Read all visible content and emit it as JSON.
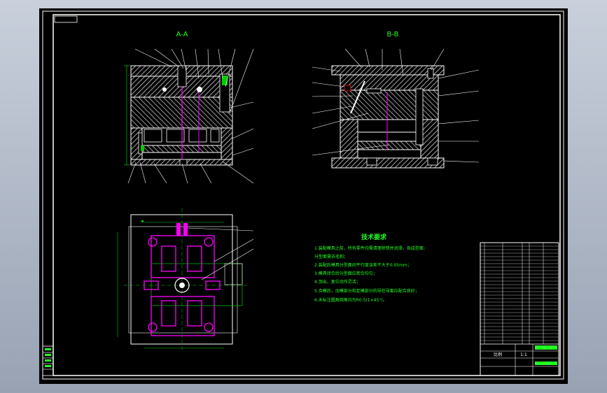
{
  "drawing": {
    "section_aa_title": "A-A",
    "section_bb_title": "B-B",
    "tech_title": "技术要求",
    "tech_notes": [
      "1.装配模具之前，所有零件均需清理除锈并润滑，各成型面、",
      "  分型面需去毛刺；",
      "2.装配后模具分型面间平行度误差不大于0.05mm；",
      "3.模具闭合后分型面应密合均匀；",
      "4.顶出、复位动作灵活；",
      "5.合模后，动模部分和定模部分的导柱导套应配合良好；",
      "6.未标注圆角倒角均为R0.5(1×45°)。"
    ],
    "title_block": {
      "scale_label": "比例",
      "scale_value": "1:1"
    }
  },
  "colors": {
    "background": "#000000",
    "frame": "#ffffff",
    "hatch": "#ffffff",
    "dimension": "#00cc00",
    "text_green": "#22ff22",
    "parts_magenta": "#ff00ff",
    "title_green": "#33ff33"
  }
}
